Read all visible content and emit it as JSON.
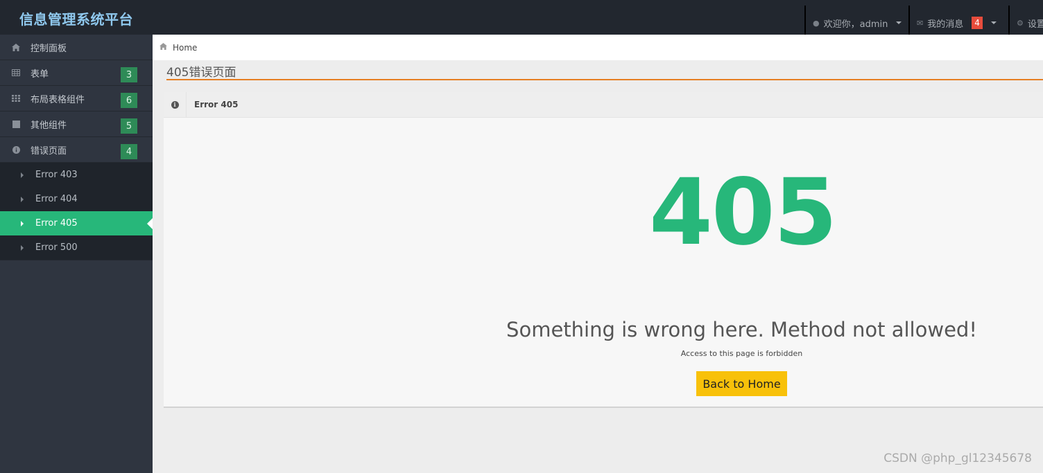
{
  "brand": "信息管理系统平台",
  "topnav": {
    "welcome": "欢迎你，admin",
    "messages_label": "我的消息",
    "messages_count": "4",
    "settings_label": "设置"
  },
  "sidebar": {
    "items": [
      {
        "label": "控制面板",
        "icon": "home-icon"
      },
      {
        "label": "表单",
        "icon": "table-icon",
        "badge": "3"
      },
      {
        "label": "布局表格组件",
        "icon": "grid-icon",
        "badge": "6"
      },
      {
        "label": "其他组件",
        "icon": "square-icon",
        "badge": "5"
      },
      {
        "label": "错误页面",
        "icon": "info-icon",
        "badge": "4"
      }
    ],
    "submenu": [
      {
        "label": "Error 403"
      },
      {
        "label": "Error 404"
      },
      {
        "label": "Error 405",
        "active": true
      },
      {
        "label": "Error 500"
      }
    ]
  },
  "breadcrumb": {
    "home": "Home"
  },
  "page": {
    "title": "405错误页面"
  },
  "panel": {
    "title": "Error 405",
    "code": "405",
    "message": "Something is wrong here. Method not allowed!",
    "sub": "Access to this page is forbidden",
    "button": "Back to Home"
  },
  "watermark": "CSDN @php_gl12345678",
  "colors": {
    "accent": "#27b77a",
    "badge": "#2e8b57",
    "button": "#f8c10a",
    "rule": "#e67e22",
    "msg_badge": "#e74c3c"
  }
}
